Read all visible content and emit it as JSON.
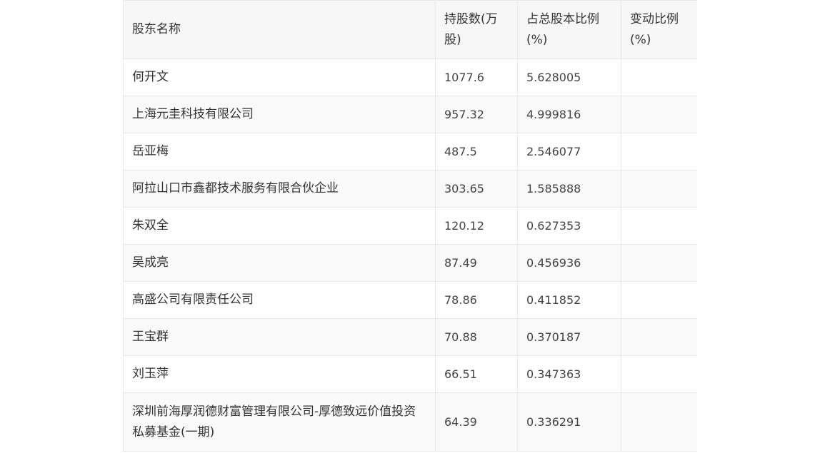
{
  "table": {
    "headers": {
      "name": "股东名称",
      "shares": "持股数(万股)",
      "ratio": "占总股本比例(%)",
      "change": "变动比例(%)"
    },
    "rows": [
      {
        "name": "何开文",
        "shares": "1077.6",
        "ratio": "5.628005",
        "change": ""
      },
      {
        "name": "上海元圭科技有限公司",
        "shares": "957.32",
        "ratio": "4.999816",
        "change": ""
      },
      {
        "name": "岳亚梅",
        "shares": "487.5",
        "ratio": "2.546077",
        "change": ""
      },
      {
        "name": "阿拉山口市鑫都技术服务有限合伙企业",
        "shares": "303.65",
        "ratio": "1.585888",
        "change": ""
      },
      {
        "name": "朱双全",
        "shares": "120.12",
        "ratio": "0.627353",
        "change": ""
      },
      {
        "name": "吴成亮",
        "shares": "87.49",
        "ratio": "0.456936",
        "change": ""
      },
      {
        "name": "高盛公司有限责任公司",
        "shares": "78.86",
        "ratio": "0.411852",
        "change": ""
      },
      {
        "name": "王宝群",
        "shares": "70.88",
        "ratio": "0.370187",
        "change": ""
      },
      {
        "name": "刘玉萍",
        "shares": "66.51",
        "ratio": "0.347363",
        "change": ""
      },
      {
        "name": "深圳前海厚润德财富管理有限公司-厚德致远价值投资私募基金(一期)",
        "shares": "64.39",
        "ratio": "0.336291",
        "change": ""
      }
    ]
  }
}
